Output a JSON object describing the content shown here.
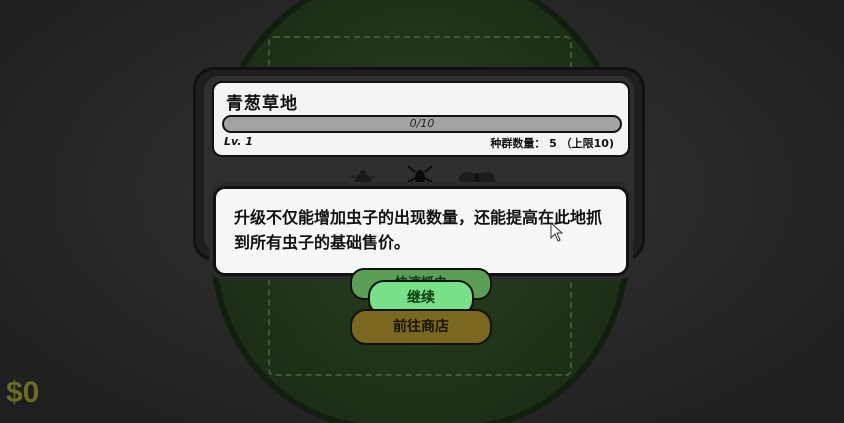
{
  "area": {
    "title": "青葱草地",
    "progress_text": "0/10",
    "progress_fraction": 0,
    "level": "Lv. 1",
    "population": "种群数量： 5 （上限10)"
  },
  "tooltip": {
    "text": "升级不仅能增加虫子的出现数量，还能提高在此地抓到所有虫子的基础售价。"
  },
  "buttons": {
    "hidden_label": "快速抓虫",
    "continue_label": "继续",
    "shop_label": "前往商店"
  },
  "hud": {
    "money": "$0"
  },
  "colors": {
    "accent_green": "#79e08a",
    "shop_gold": "#7a6820",
    "money_gold": "#6b6b27"
  }
}
